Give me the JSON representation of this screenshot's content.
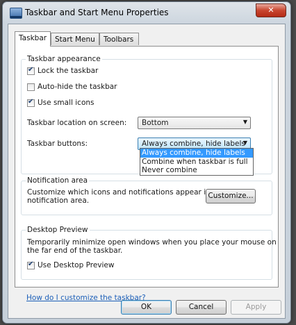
{
  "window": {
    "title": "Taskbar and Start Menu Properties",
    "close_glyph": "✕"
  },
  "tabs": [
    {
      "label": "Taskbar",
      "active": true
    },
    {
      "label": "Start Menu",
      "active": false
    },
    {
      "label": "Toolbars",
      "active": false
    }
  ],
  "taskbar_appearance": {
    "title": "Taskbar appearance",
    "lock_taskbar": {
      "label": "Lock the taskbar",
      "checked": true
    },
    "auto_hide": {
      "label": "Auto-hide the taskbar",
      "checked": false
    },
    "small_icons": {
      "label": "Use small icons",
      "checked": true
    },
    "location_label": "Taskbar location on screen:",
    "location_value": "Bottom",
    "buttons_label": "Taskbar buttons:",
    "buttons_value": "Always combine, hide labels",
    "buttons_options": [
      "Always combine, hide labels",
      "Combine when taskbar is full",
      "Never combine"
    ]
  },
  "notification_area": {
    "title": "Notification area",
    "line1": "Customize which icons and notifications appear in the",
    "line2": "notification area.",
    "customize_label": "Customize..."
  },
  "desktop_preview": {
    "title": "Desktop Preview",
    "line1": "Temporarily minimize open windows when you place your mouse on",
    "line2": "the far end of the taskbar.",
    "use_preview": {
      "label": "Use Desktop Preview",
      "checked": true
    }
  },
  "help_link": "How do I customize the taskbar?",
  "buttons": {
    "ok": "OK",
    "cancel": "Cancel",
    "apply": "Apply"
  },
  "colors": {
    "selection": "#3399ff",
    "link": "#1c5fb8",
    "close_button": "#c8452f"
  }
}
